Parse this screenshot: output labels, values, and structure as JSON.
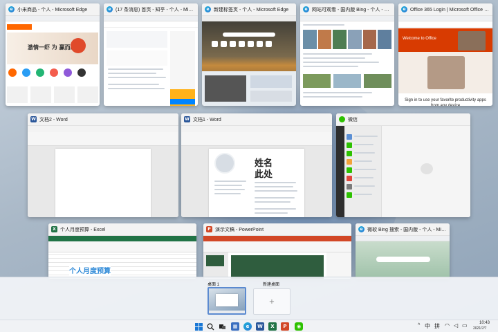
{
  "windows": [
    {
      "title": "小米商品 - 个人 - Microsoft Edge",
      "app": "edge"
    },
    {
      "title": "(17 条消息) 首页 - 知乎 - 个人 - Microsoft...",
      "app": "edge"
    },
    {
      "title": "新建标签页 - 个人 - Microsoft Edge",
      "app": "edge"
    },
    {
      "title": "网站可观看 - 国内版 Bing - 个人 - Microsoft...",
      "app": "edge"
    },
    {
      "title": "Office 365 Login | Microsoft Office - 个人...",
      "app": "edge"
    },
    {
      "title": "文档2 - Word",
      "app": "word"
    },
    {
      "title": "文档1 - Word",
      "app": "word"
    },
    {
      "title": "微信",
      "app": "wechat"
    },
    {
      "title": "个人月度预算 - Excel",
      "app": "excel"
    },
    {
      "title": "演示文稿 - PowerPoint",
      "app": "ppt"
    },
    {
      "title": "微软 Bing 搜索 - 国内版 - 个人 - Microsoft...",
      "app": "edge"
    }
  ],
  "thumbs": {
    "mi_banner": "激情一虾 为 赢而战",
    "office_welcome": "Welcome to Office",
    "office_signin": "Sign in to use your favorite productivity apps from any device",
    "resume_name": "姓名",
    "resume_here": "此处",
    "excel_title": "个人月度预算"
  },
  "desktops": [
    {
      "label": "桌面 1"
    },
    {
      "label": "新建桌面"
    }
  ],
  "tray": {
    "ime_lang": "中",
    "ime_mode": "拼",
    "time": "10:43",
    "date": "2021/7/7"
  },
  "colors": {
    "edge": "#2b7bd6",
    "word": "#2b579a",
    "excel": "#217346",
    "powerpoint": "#d24726",
    "wechat": "#2dc100"
  }
}
